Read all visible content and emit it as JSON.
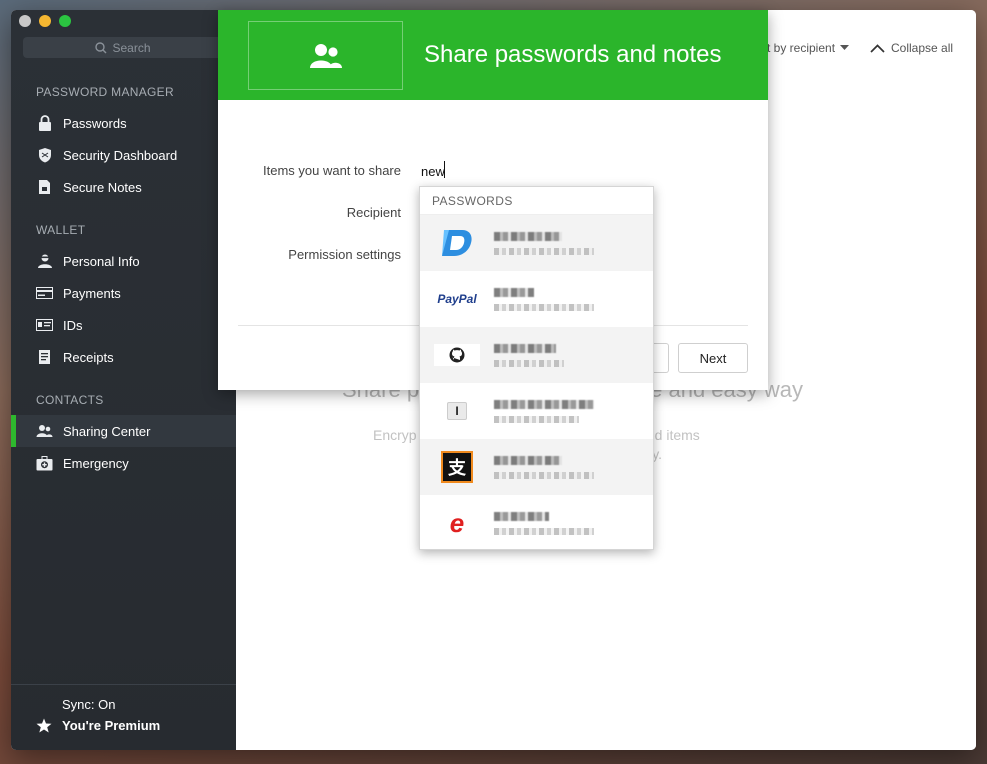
{
  "sidebar": {
    "search_placeholder": "Search",
    "sections": {
      "password_manager": "PASSWORD MANAGER",
      "wallet": "WALLET",
      "contacts": "CONTACTS"
    },
    "items": [
      {
        "label": "Passwords",
        "icon": "lock-icon"
      },
      {
        "label": "Security Dashboard",
        "icon": "shield-icon"
      },
      {
        "label": "Secure Notes",
        "icon": "note-icon"
      },
      {
        "label": "Personal Info",
        "icon": "person-icon"
      },
      {
        "label": "Payments",
        "icon": "card-icon"
      },
      {
        "label": "IDs",
        "icon": "id-card-icon"
      },
      {
        "label": "Receipts",
        "icon": "receipt-icon"
      },
      {
        "label": "Sharing Center",
        "icon": "sharing-icon"
      },
      {
        "label": "Emergency",
        "icon": "medkit-icon"
      }
    ],
    "sync": "Sync: On",
    "premium": "You're Premium"
  },
  "main": {
    "sort_label": "rt by recipient",
    "collapse_label": "Collapse all",
    "bg_title": "Share p                            he safe and easy way",
    "bg_sub": "Encryp                              s. Updates to shared items",
    "bg_sub2": "lly."
  },
  "dialog": {
    "title": "Share passwords and notes",
    "labels": {
      "items": "Items you want to share",
      "recipient": "Recipient",
      "permission": "Permission settings"
    },
    "items_value": "new",
    "next_label": "Next"
  },
  "dropdown": {
    "header": "PASSWORDS",
    "rows": [
      {
        "logo": "dashlane-d-logo"
      },
      {
        "logo": "paypal-logo",
        "text": "PayPal"
      },
      {
        "logo": "github-logo"
      },
      {
        "logo": "letter-i-logo",
        "text": "I"
      },
      {
        "logo": "alipay-logo",
        "text": "支"
      },
      {
        "logo": "weibo-logo",
        "text": "e"
      }
    ]
  },
  "colors": {
    "accent": "#2bb52b",
    "sidebar_bg": "#2b3036"
  }
}
